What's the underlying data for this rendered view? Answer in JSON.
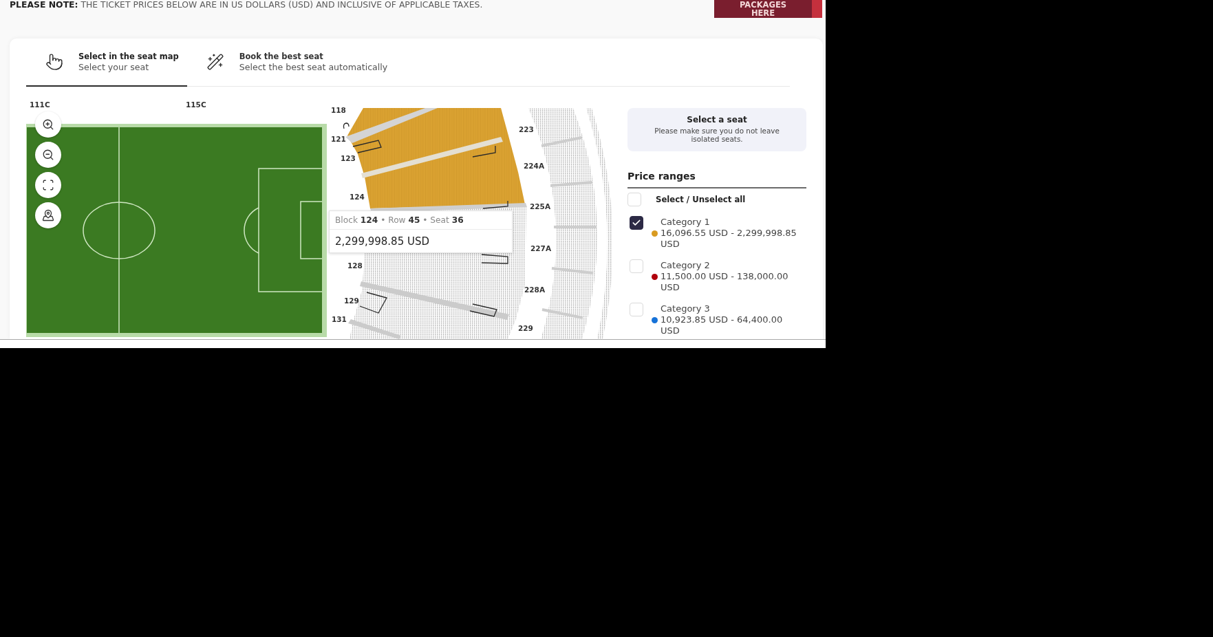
{
  "notice": "**PLEASE NOTE:** THE TICKET PRICES BELOW ARE IN US DOLLARS (USD) AND INCLUSIVE OF APPLICABLE TAXES.",
  "packages_button": {
    "lines": [
      "PACKAGES",
      "HERE"
    ]
  },
  "tabs": [
    {
      "kind": "map",
      "title": "Select in the seat map",
      "subtitle": "Select your seat",
      "selected": true
    },
    {
      "kind": "auto",
      "title": "Book the best seat",
      "subtitle": "Select the best seat automatically",
      "selected": false
    }
  ],
  "seat_map": {
    "section_labels": [
      "111C",
      "115C",
      "118",
      "121",
      "123",
      "124",
      "128",
      "129",
      "131",
      "223",
      "224A",
      "225A",
      "227A",
      "228A",
      "229"
    ],
    "zoom_controls": [
      {
        "kind": "zoom_in"
      },
      {
        "kind": "zoom_out"
      },
      {
        "kind": "fit"
      },
      {
        "kind": "locate"
      }
    ],
    "tooltip": {
      "seat": "Block **124** • Row **45** • Seat **36**",
      "price": "2,299,998.85 USD"
    }
  },
  "seat_info": {
    "title": "Select a seat",
    "text": "Please make sure you do not leave isolated seats."
  },
  "price_ranges": {
    "title": "Price ranges",
    "select_all": {
      "label": "Select / Unselect all",
      "checked": false
    },
    "categories": [
      {
        "name": "Category 1",
        "range": "16,096.55 USD - 2,299,998.85 USD",
        "color": "#d99b21",
        "checked": true
      },
      {
        "name": "Category 2",
        "range": "11,500.00 USD - 138,000.00 USD",
        "color": "#b0000c",
        "checked": false
      },
      {
        "name": "Category 3",
        "range": "10,923.85 USD - 64,400.00 USD",
        "color": "#1672d8",
        "checked": false
      }
    ]
  }
}
